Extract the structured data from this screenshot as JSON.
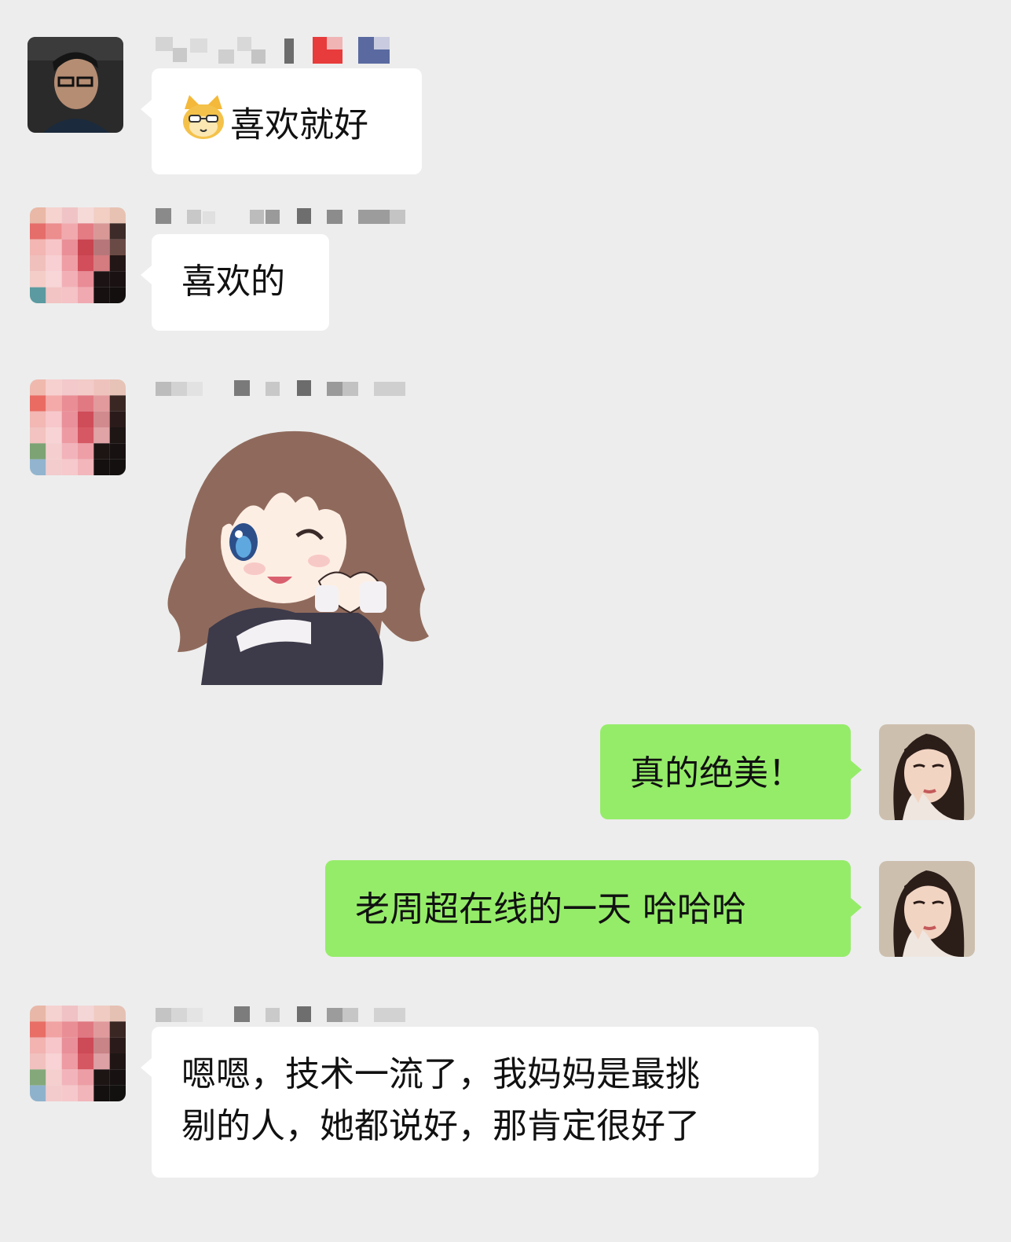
{
  "messages": [
    {
      "sender": "left",
      "emoji": "cat-face-emoji",
      "text": "喜欢就好"
    },
    {
      "sender": "left",
      "text": "喜欢的"
    },
    {
      "sender": "left",
      "sticker": "anime-girl-heart-sticker"
    },
    {
      "sender": "right",
      "text": "真的绝美！"
    },
    {
      "sender": "right",
      "text": "老周超在线的一天 哈哈哈"
    },
    {
      "sender": "left",
      "text_line1": "嗯嗯，技术一流了，我妈妈是最挑",
      "text_line2": "剔的人，她都说好，那肯定很好了"
    }
  ],
  "colors": {
    "background": "#ededed",
    "incoming_bubble": "#ffffff",
    "outgoing_bubble": "#95ec69"
  }
}
